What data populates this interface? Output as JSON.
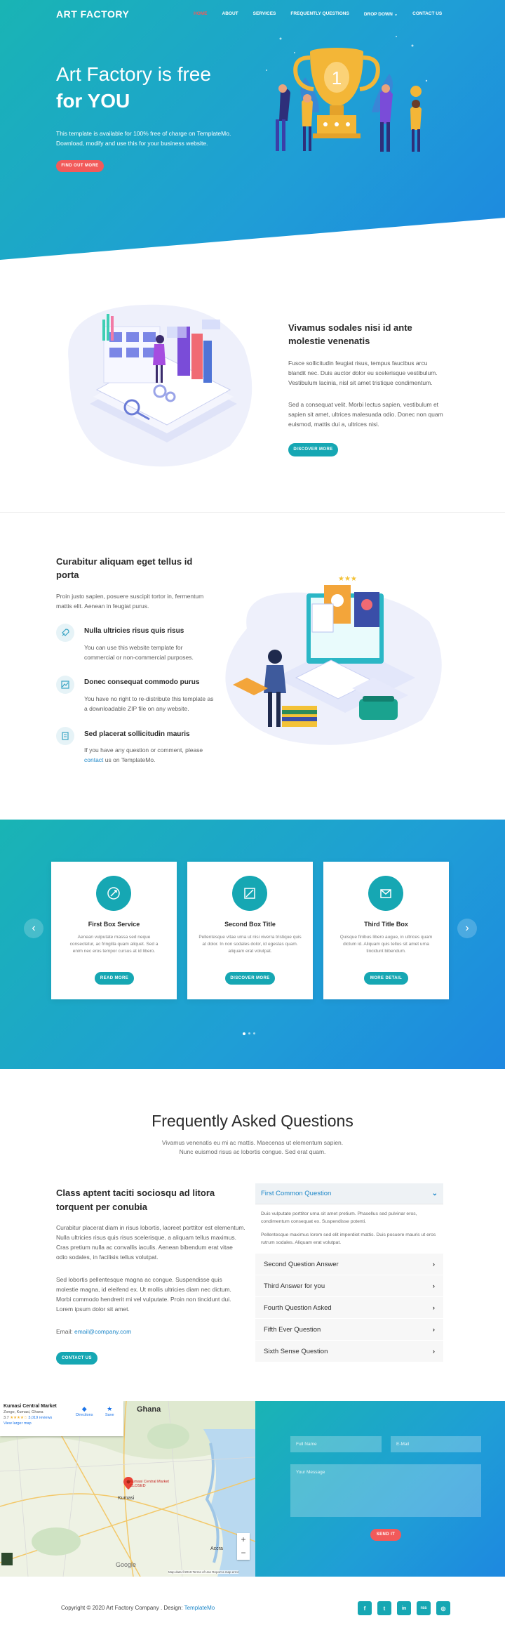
{
  "nav": {
    "brand": "ART FACTORY",
    "items": [
      {
        "label": "HOME",
        "active": true
      },
      {
        "label": "ABOUT"
      },
      {
        "label": "SERVICES"
      },
      {
        "label": "FREQUENTLY QUESTIONS"
      },
      {
        "label": "DROP DOWN"
      },
      {
        "label": "CONTACT US"
      }
    ]
  },
  "hero": {
    "title_line1": "Art Factory is free",
    "title_line2": "for YOU",
    "text": "This template is available for 100% free of charge on TemplateMo. Download, modify and use this for your business website.",
    "button": "FIND OUT MORE",
    "trophy_number": "1"
  },
  "about": {
    "title": "Vivamus sodales nisi id ante molestie venenatis",
    "p1": "Fusce sollicitudin feugiat risus, tempus faucibus arcu blandit nec. Duis auctor dolor eu scelerisque vestibulum. Vestibulum lacinia, nisl sit amet tristique condimentum.",
    "p2": "Sed a consequat velit. Morbi lectus sapien, vestibulum et sapien sit amet, ultrices malesuada odio. Donec non quam euismod, mattis dui a, ultrices nisi.",
    "button": "DISCOVER MORE"
  },
  "features": {
    "title": "Curabitur aliquam eget tellus id porta",
    "intro": "Proin justo sapien, posuere suscipit tortor in, fermentum mattis elit. Aenean in feugiat purus.",
    "items": [
      {
        "title": "Nulla ultricies risus quis risus",
        "text": "You can use this website template for commercial or non-commercial purposes."
      },
      {
        "title": "Donec consequat commodo purus",
        "text": "You have no right to re-distribute this template as a downloadable ZIP file on any website."
      },
      {
        "title": "Sed placerat sollicitudin mauris",
        "text_before": "If you have any question or comment, please",
        "link": "contact",
        "text_after": "us on TemplateMo."
      }
    ]
  },
  "services": {
    "prev": "‹",
    "next": "›",
    "cards": [
      {
        "title": "First Box Service",
        "text": "Aenean vulputate massa sed neque consectetur, ac fringilla quam aliquet. Sed a enim nec eros tempor cursus at id libero.",
        "button": "READ MORE"
      },
      {
        "title": "Second Box Title",
        "text": "Pellentesque vitae urna ut nisi viverra tristique quis at dolor. In non sodales dolor, id egestas quam. aliquam erat volutpat.",
        "button": "DISCOVER MORE"
      },
      {
        "title": "Third Title Box",
        "text": "Quisque finibus libero augue, in ultrices quam dictum id. Aliquam quis tellus sit amet urna tincidunt bibendum.",
        "button": "MORE DETAIL"
      }
    ]
  },
  "faq": {
    "title": "Frequently Asked Questions",
    "sub1": "Vivamus venenatis eu mi ac mattis. Maecenas ut elementum sapien.",
    "sub2": "Nunc euismod risus ac lobortis congue. Sed erat quam.",
    "left_title": "Class aptent taciti sociosqu ad litora torquent per conubia",
    "left_p1": "Curabitur placerat diam in risus lobortis, laoreet porttitor est elementum. Nulla ultricies risus quis risus scelerisque, a aliquam tellus maximus. Cras pretium nulla ac convallis iaculis. Aenean bibendum erat vitae odio sodales, in facilisis tellus volutpat.",
    "left_p2": "Sed lobortis pellentesque magna ac congue. Suspendisse quis molestie magna, id eleifend ex. Ut mollis ultricies diam nec dictum. Morbi commodo hendrerit mi vel vulputate. Proin non tincidunt dui. Lorem ipsum dolor sit amet.",
    "email_label": "Email:",
    "email": "email@company.com",
    "button": "CONTACT US",
    "open_question": "First Common Question",
    "open_p1": "Duis vulputate porttitor urna sit amet pretium. Phasellus sed pulvinar eros, condimentum consequat ex. Suspendisse potenti.",
    "open_p2": "Pellentesque maximus lorem sed elit imperdiet mattis. Duis posuere mauris ut eros rutrum sodales. Aliquam erat volutpat.",
    "questions": [
      "Second Question Answer",
      "Third Answer for you",
      "Fourth Question Asked",
      "Fifth Ever Question",
      "Sixth Sense Question"
    ]
  },
  "map": {
    "place": "Kumasi Central Market",
    "address": "Zongo, Kumasi, Ghana",
    "rating": "3.7",
    "stars": "★★★★☆",
    "reviews": "3,019 reviews",
    "larger": "View larger map",
    "directions": "Directions",
    "save": "Save",
    "country": "Ghana",
    "marker_label": "Kumasi Central Market",
    "marker_status": "CLOSED",
    "city1": "Kumasi",
    "city2": "Accra",
    "logo": "Google",
    "attribution": "Map data ©2019   Terms of Use   Report a map error",
    "zoom_in": "+",
    "zoom_out": "−"
  },
  "contact": {
    "name_ph": "Full Name",
    "email_ph": "E-Mail",
    "message_ph": "Your Message",
    "button": "SEND IT"
  },
  "footer": {
    "copyright": "Copyright © 2020 Art Factory Company . Design:",
    "design_link": "TemplateMo",
    "social": [
      "f",
      "t",
      "in",
      "rss",
      "◎"
    ]
  },
  "colors": {
    "accent": "#16a7b3",
    "cta": "#f25a5a",
    "grad_start": "#19b4b4",
    "grad_end": "#1e88e0"
  }
}
